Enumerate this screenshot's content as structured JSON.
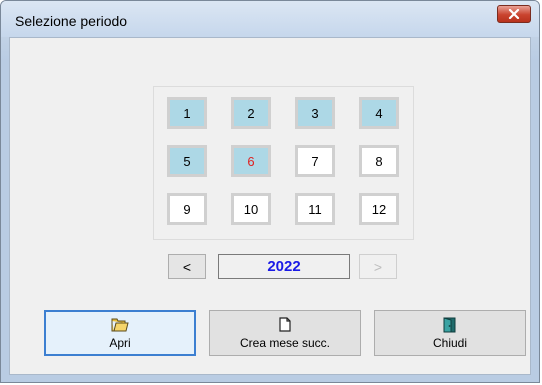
{
  "window": {
    "title": "Selezione periodo"
  },
  "months": [
    {
      "label": "1",
      "active": true,
      "current": false
    },
    {
      "label": "2",
      "active": true,
      "current": false
    },
    {
      "label": "3",
      "active": true,
      "current": false
    },
    {
      "label": "4",
      "active": true,
      "current": false
    },
    {
      "label": "5",
      "active": true,
      "current": false
    },
    {
      "label": "6",
      "active": true,
      "current": true
    },
    {
      "label": "7",
      "active": false,
      "current": false
    },
    {
      "label": "8",
      "active": false,
      "current": false
    },
    {
      "label": "9",
      "active": false,
      "current": false
    },
    {
      "label": "10",
      "active": false,
      "current": false
    },
    {
      "label": "11",
      "active": false,
      "current": false
    },
    {
      "label": "12",
      "active": false,
      "current": false
    }
  ],
  "year_nav": {
    "prev_label": "<",
    "year": "2022",
    "next_label": ">",
    "next_enabled": false
  },
  "buttons": {
    "open": {
      "label": "Apri",
      "icon": "folder-icon"
    },
    "create_next": {
      "label": "Crea mese succ.",
      "icon": "new-document-icon"
    },
    "close": {
      "label": "Chiudi",
      "icon": "exit-door-icon"
    }
  },
  "colors": {
    "active_month": "#add8e6",
    "current_month_text": "#e02020",
    "year_text": "#1a1ae6",
    "focus_border": "#3c7fd1"
  }
}
